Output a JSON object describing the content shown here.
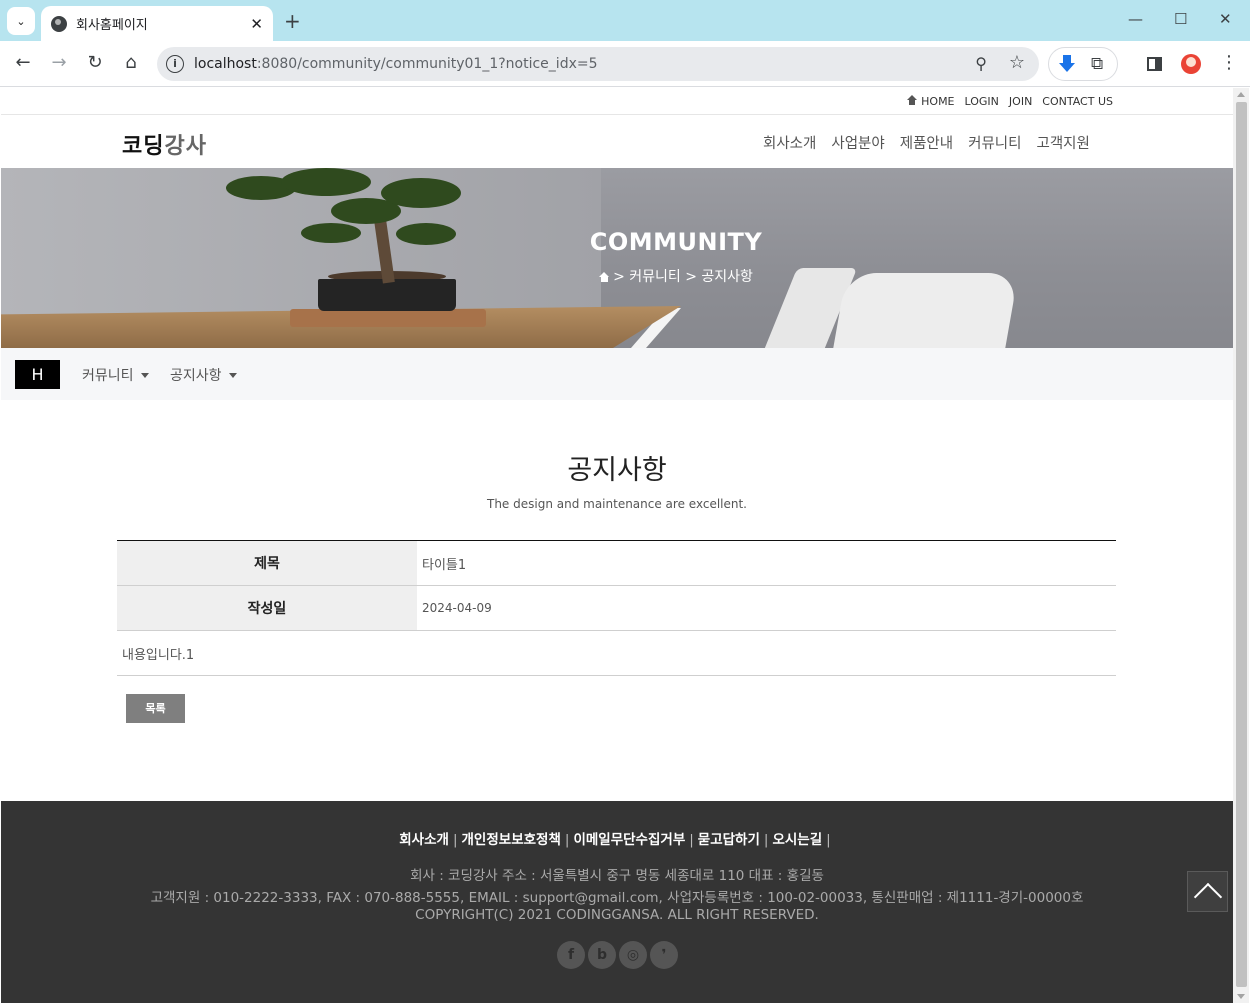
{
  "browser": {
    "tab_title": "회사홈페이지",
    "url_host": "localhost",
    "url_rest": ":8080/community/community01_1?notice_idx=5",
    "icons": [
      "tab-search-icon",
      "globe-icon",
      "close-icon",
      "plus-icon",
      "minimize-icon",
      "maximize-icon",
      "window-close-icon",
      "back-icon",
      "forward-icon",
      "reload-icon",
      "home-icon",
      "info-icon",
      "zoom-icon",
      "star-icon",
      "download-extension-icon",
      "puzzle-icon",
      "side-panel-icon",
      "profile-avatar",
      "menu-icon"
    ]
  },
  "topbar": {
    "home": "HOME",
    "login": "LOGIN",
    "join": "JOIN",
    "contact": "CONTACT US"
  },
  "header": {
    "logo_main": "코딩",
    "logo_sub": "강사",
    "nav": [
      "회사소개",
      "사업분야",
      "제품안내",
      "커뮤니티",
      "고객지원"
    ]
  },
  "hero": {
    "title": "COMMUNITY",
    "breadcrumb": "> 커뮤니티 > 공지사항"
  },
  "subnav": {
    "home_label": "H",
    "menu1": "커뮤니티",
    "menu2": "공지사항"
  },
  "section": {
    "title": "공지사항",
    "subtitle": "The design and maintenance are excellent."
  },
  "notice": {
    "title_label": "제목",
    "title_value": "타이틀1",
    "date_label": "작성일",
    "date_value": "2024-04-09",
    "content": "내용입니다.1",
    "list_button": "목록"
  },
  "footer": {
    "links": [
      "회사소개",
      "개인정보보호정책",
      "이메일무단수집거부",
      "묻고답하기",
      "오시는길"
    ],
    "sep": "|",
    "line1": "회사 : 코딩강사   주소 : 서울특별시 중구 명동 세종대로 110   대표 : 홍길동",
    "line2": "고객지원 : 010-2222-3333, FAX : 070-888-5555, EMAIL : support@gmail.com, 사업자등록번호 : 100-02-00033, 통신판매업 : 제1111-경기-00000호",
    "line3": "COPYRIGHT(C) 2021 CODINGGANSA. ALL RIGHT RESERVED.",
    "socials": [
      "f",
      "b",
      "◎",
      "❜"
    ]
  }
}
